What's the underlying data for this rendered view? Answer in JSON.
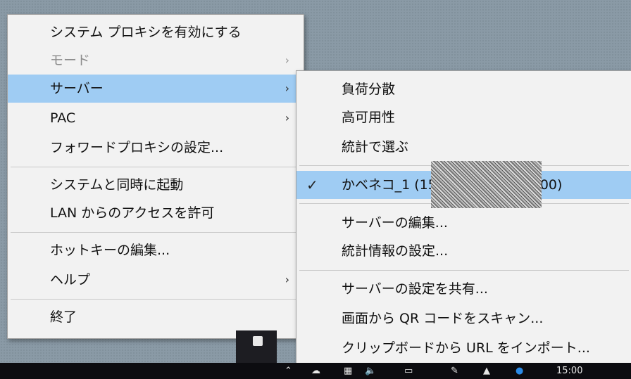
{
  "main_menu": {
    "items": [
      {
        "label": "システム プロキシを有効にする"
      },
      {
        "label": "モード",
        "arrow": "›"
      },
      {
        "label": "サーバー",
        "arrow": "›"
      },
      {
        "label": "PAC",
        "arrow": "›"
      },
      {
        "label": "フォワードプロキシの設定..."
      },
      {
        "label": "システムと同時に起動"
      },
      {
        "label": "LAN からのアクセスを許可"
      },
      {
        "label": "ホットキーの編集..."
      },
      {
        "label": "ヘルプ",
        "arrow": "›"
      },
      {
        "label": "終了"
      }
    ]
  },
  "server_submenu": {
    "items": [
      {
        "label": "負荷分散"
      },
      {
        "label": "高可用性"
      },
      {
        "label": "統計で選ぶ"
      },
      {
        "label": "かベネコ_1 (15",
        "label_suffix": "00)",
        "check": "✓"
      },
      {
        "label": "サーバーの編集..."
      },
      {
        "label": "統計情報の設定..."
      },
      {
        "label": "サーバーの設定を共有..."
      },
      {
        "label": "画面から QR コードをスキャン..."
      },
      {
        "label": "クリップボードから URL をインポート..."
      }
    ]
  },
  "taskbar": {
    "clock": "15:00"
  },
  "colors": {
    "highlight": "#9fccf3",
    "menu_bg": "#f2f2f2",
    "disabled_text": "#8c8c8c"
  }
}
